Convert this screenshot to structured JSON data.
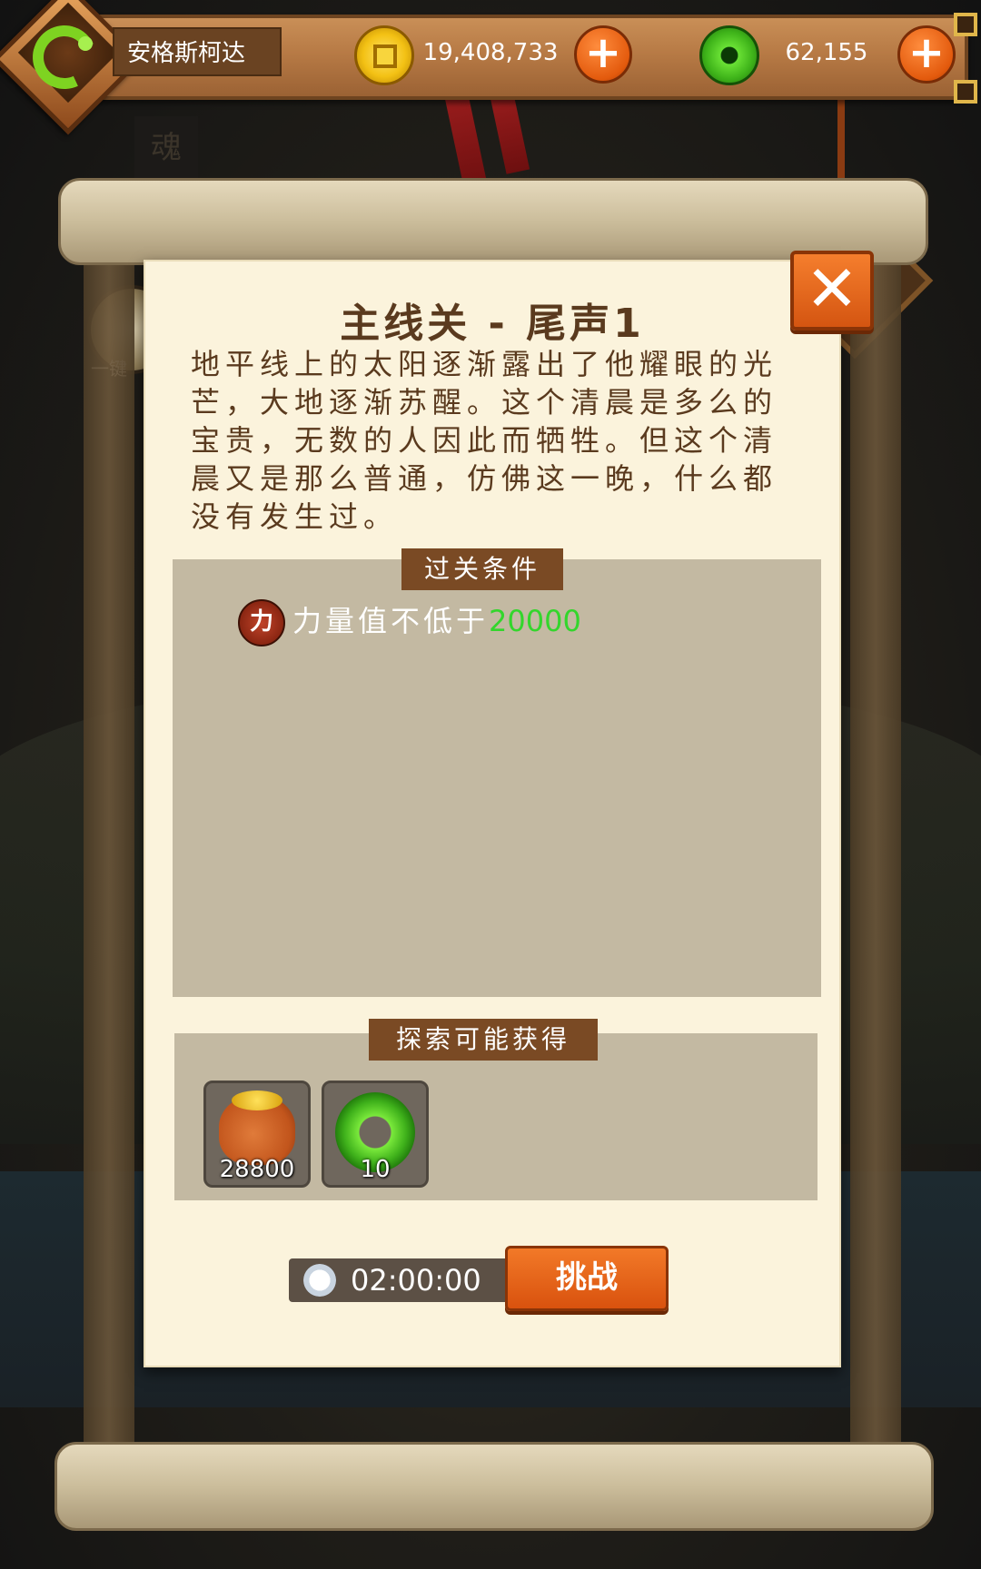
{
  "player": {
    "name": "安格斯柯达"
  },
  "currency": {
    "gold": {
      "value": "19,408,733",
      "icon": "gold-coin-icon"
    },
    "jade": {
      "value": "62,155",
      "icon": "jade-ring-icon"
    },
    "add_label": "+"
  },
  "background": {
    "tag_char": "魂",
    "medallion_label": "一键"
  },
  "stage": {
    "title": "主线关 - 尾声1",
    "story": "地平线上的太阳逐渐露出了他耀眼的光芒，大地逐渐苏醒。这个清晨是多么的宝贵，无数的人因此而牺牲。但这个清晨又是那么普通，仿佛这一晚，什么都没有发生过。"
  },
  "conditions": {
    "title": "过关条件",
    "items": [
      {
        "icon_char": "力",
        "text": "力量值不低于",
        "value": "20000",
        "value_color": "#33d62c"
      }
    ]
  },
  "rewards": {
    "title": "探索可能获得",
    "items": [
      {
        "icon": "gold-bag-icon",
        "amount": "28800"
      },
      {
        "icon": "jade-ring-icon",
        "amount": "10"
      }
    ]
  },
  "timer": {
    "value": "02:00:00"
  },
  "actions": {
    "close_label": "✕",
    "challenge_label": "挑战"
  }
}
